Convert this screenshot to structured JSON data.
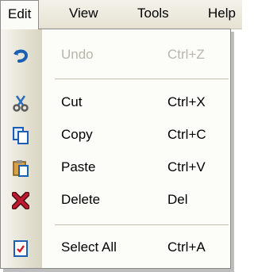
{
  "menubar": {
    "items": [
      {
        "label": "Edit"
      },
      {
        "label": "View"
      },
      {
        "label": "Tools"
      },
      {
        "label": "Help"
      }
    ]
  },
  "edit_menu": {
    "items": [
      {
        "label": "Undo",
        "shortcut": "Ctrl+Z",
        "enabled": false,
        "icon": "undo-icon"
      },
      {
        "label": "Cut",
        "shortcut": "Ctrl+X",
        "enabled": true,
        "icon": "scissors-icon"
      },
      {
        "label": "Copy",
        "shortcut": "Ctrl+C",
        "enabled": true,
        "icon": "copy-icon"
      },
      {
        "label": "Paste",
        "shortcut": "Ctrl+V",
        "enabled": true,
        "icon": "paste-icon"
      },
      {
        "label": "Delete",
        "shortcut": "Del",
        "enabled": true,
        "icon": "delete-icon"
      },
      {
        "label": "Select All",
        "shortcut": "Ctrl+A",
        "enabled": true,
        "icon": "select-all-icon"
      }
    ]
  },
  "colors": {
    "accent_blue": "#1a5fb4",
    "disabled_text": "#b9b6aa",
    "delete_red": "#b3122e"
  }
}
